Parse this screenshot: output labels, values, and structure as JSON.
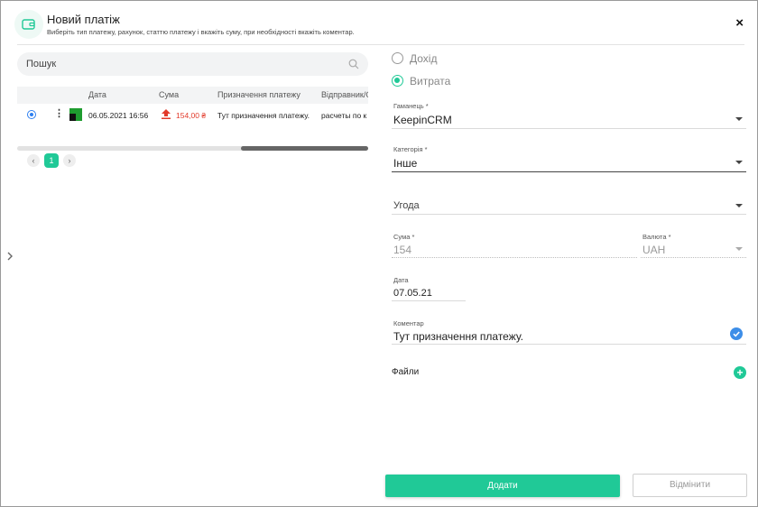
{
  "header": {
    "title": "Новий платіж",
    "subtitle": "Виберіть тип платежу, рахунок, статтю платежу і вкажіть суму, при необхідності вкажіть коментар.",
    "close_label": "×"
  },
  "search": {
    "placeholder": "Пошук",
    "value": ""
  },
  "table": {
    "columns": [
      "Дата",
      "Сума",
      "Призначення платежу",
      "Відправник/О"
    ],
    "rows": [
      {
        "date": "06.05.2021 16:56",
        "amount": "154,00 ₴",
        "purpose": "Тут призначення платежу.",
        "sender": "расчеты по к"
      }
    ]
  },
  "pagination": {
    "current": "1",
    "prev": "‹",
    "next": "›"
  },
  "form": {
    "type_income": "Дохід",
    "type_expense": "Витрата",
    "selected_type": "Витрата",
    "wallet_label": "Гаманець *",
    "wallet_value": "KeepinCRM",
    "category_label": "Категорія *",
    "category_value": "Інше",
    "deal_placeholder": "Угода",
    "amount_label": "Сума *",
    "amount_value": "154",
    "currency_label": "Валюта *",
    "currency_value": "UAH",
    "date_label": "Дата",
    "date_value": "07.05.21",
    "comment_label": "Коментар",
    "comment_value": "Тут призначення платежу.",
    "files_label": "Файли"
  },
  "actions": {
    "add_label": "Додати",
    "cancel_label": "Відмінити"
  },
  "colors": {
    "accent": "#20c997",
    "amount_out": "#e23a2a",
    "radio_blue": "#2d7ff0",
    "check_blue": "#3d8ee8"
  },
  "icons": [
    "wallet-icon",
    "close-icon",
    "search-icon",
    "kebab-menu-icon",
    "upload-arrow-icon",
    "chevron-left-icon",
    "chevron-right-icon",
    "chevron-down-icon",
    "checkmark-icon",
    "plus-icon"
  ]
}
